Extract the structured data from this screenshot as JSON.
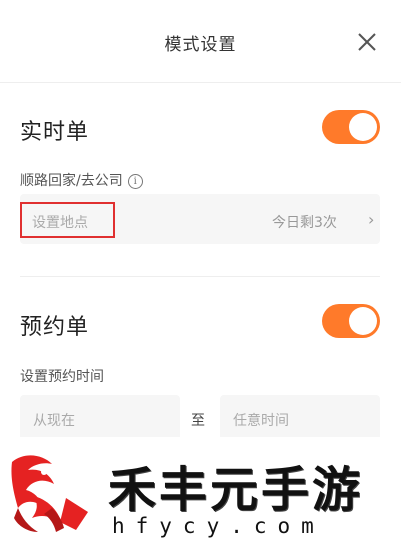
{
  "header": {
    "title": "模式设置",
    "close_icon": "close-icon"
  },
  "realtime": {
    "title": "实时单",
    "toggle_on": true,
    "route_label": "顺路回家/去公司",
    "info_icon": "info-icon",
    "info_glyph": "i",
    "address_placeholder": "设置地点",
    "remaining": "今日剩3次",
    "chevron": "›"
  },
  "reservation": {
    "title": "预约单",
    "toggle_on": true,
    "time_label": "设置预约时间",
    "start_placeholder": "从现在",
    "to_text": "至",
    "end_placeholder": "任意时间"
  },
  "watermark": {
    "brand": "禾丰元手游",
    "domain": "hfycy.com"
  },
  "colors": {
    "accent": "#ff7a2a",
    "highlight_box": "#e03030"
  }
}
